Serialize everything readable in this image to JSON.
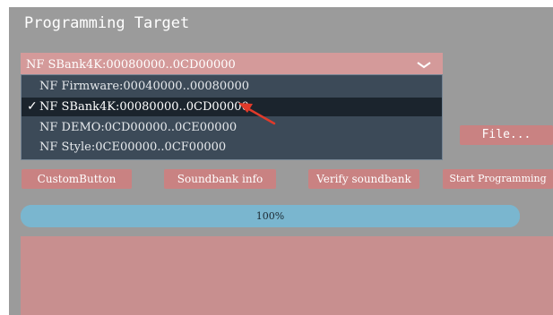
{
  "title": "Programming Target",
  "target_select": {
    "selected": "NF SBank4K:00080000..0CD00000",
    "options": [
      {
        "label": "NF Firmware:00040000..00080000",
        "active": false
      },
      {
        "label": "NF SBank4K:00080000..0CD00000",
        "active": true
      },
      {
        "label": "NF DEMO:0CD00000..0CE00000",
        "active": false
      },
      {
        "label": "NF Style:0CE00000..0CF00000",
        "active": false
      }
    ],
    "check_mark": "✓"
  },
  "file_button": "File...",
  "buttons": {
    "custom": "CustomButton",
    "soundbank_info": "Soundbank info",
    "verify": "Verify soundbank",
    "start": "Start Programming"
  },
  "progress": {
    "value": 1.0,
    "label": "100%"
  },
  "colors": {
    "panel_bg": "#9b9b9b",
    "accent_button": "#c98282",
    "dropdown_bg": "#3c4a58",
    "progress_fill": "#7ab6cf",
    "annotation_arrow": "#e03a2a"
  }
}
